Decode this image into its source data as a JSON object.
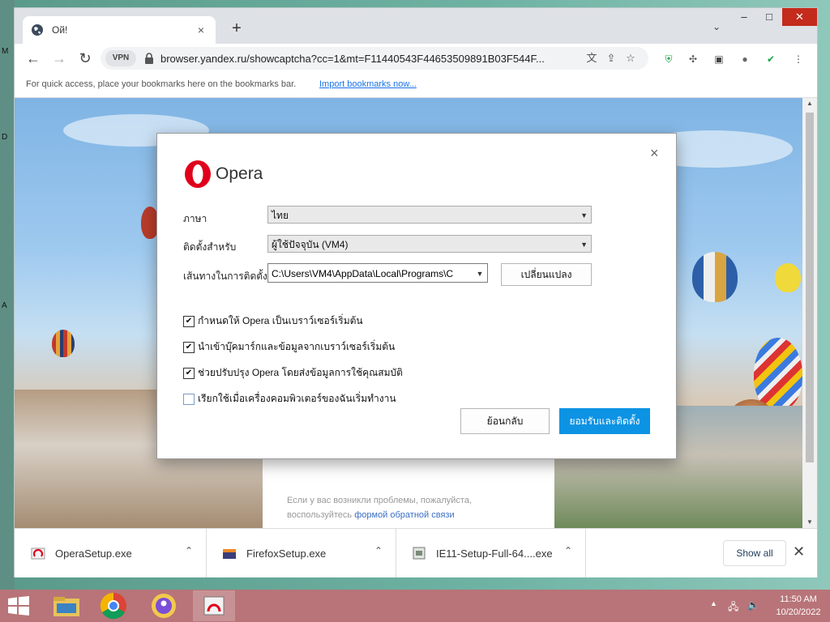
{
  "desktop": {
    "edge_letters": [
      "M",
      "D",
      "A"
    ]
  },
  "browser": {
    "tab": {
      "title": "Ой!",
      "close_label": "×"
    },
    "new_tab_label": "+",
    "tab_list_label": "⌄",
    "window_controls": {
      "minimize": "‒",
      "maximize": "□",
      "close": "✕"
    },
    "nav": {
      "back": "←",
      "forward": "→",
      "reload": "↻"
    },
    "vpn_label": "VPN",
    "url": "browser.yandex.ru/showcaptcha?cc=1&mt=F11440543F44653509891B03F544F...",
    "bookmarks_text": "For quick access, place your bookmarks here on the bookmarks bar.",
    "bookmarks_link": "Import bookmarks now..."
  },
  "page": {
    "feedback_text": "Если у вас возникли проблемы, пожалуйста, воспользуйтесь",
    "feedback_link": "формой обратной связи"
  },
  "downloads": {
    "items": [
      {
        "name": "OperaSetup.exe",
        "icon": "opera-setup-icon"
      },
      {
        "name": "FirefoxSetup.exe",
        "icon": "firefox-setup-icon"
      },
      {
        "name": "IE11-Setup-Full-64....exe",
        "icon": "ie-setup-icon"
      }
    ],
    "show_all": "Show all",
    "close": "✕"
  },
  "dialog": {
    "brand": "Opera",
    "close": "×",
    "language_label": "ภาษา",
    "language_value": "ไทย",
    "install_for_label": "ติดตั้งสำหรับ",
    "install_for_value": "ผู้ใช้ปัจจุบัน (VM4)",
    "path_label": "เส้นทางในการติดตั้ง",
    "path_value": "C:\\Users\\VM4\\AppData\\Local\\Programs\\C",
    "change_button": "เปลี่ยนแปลง",
    "options": [
      {
        "label": "กำหนดให้ Opera เป็นเบราว์เซอร์เริ่มต้น",
        "checked": true
      },
      {
        "label": "นำเข้าบุ๊คมาร์กและข้อมูลจากเบราว์เซอร์เริ่มต้น",
        "checked": true
      },
      {
        "label": "ช่วยปรับปรุง Opera โดยส่งข้อมูลการใช้คุณสมบัติ",
        "checked": true
      },
      {
        "label": "เรียกใช้เมื่อเครื่องคอมพิวเตอร์ของฉันเริ่มทำงาน",
        "checked": false
      }
    ],
    "cancel_button": "ย้อนกลับ",
    "accept_button": "ยอมรับและติดตั้ง"
  },
  "taskbar": {
    "time": "11:50 AM",
    "date": "10/20/2022"
  },
  "colors": {
    "accent": "#0d93e4",
    "opera_red": "#e0001b",
    "taskbar": "#b87478"
  }
}
